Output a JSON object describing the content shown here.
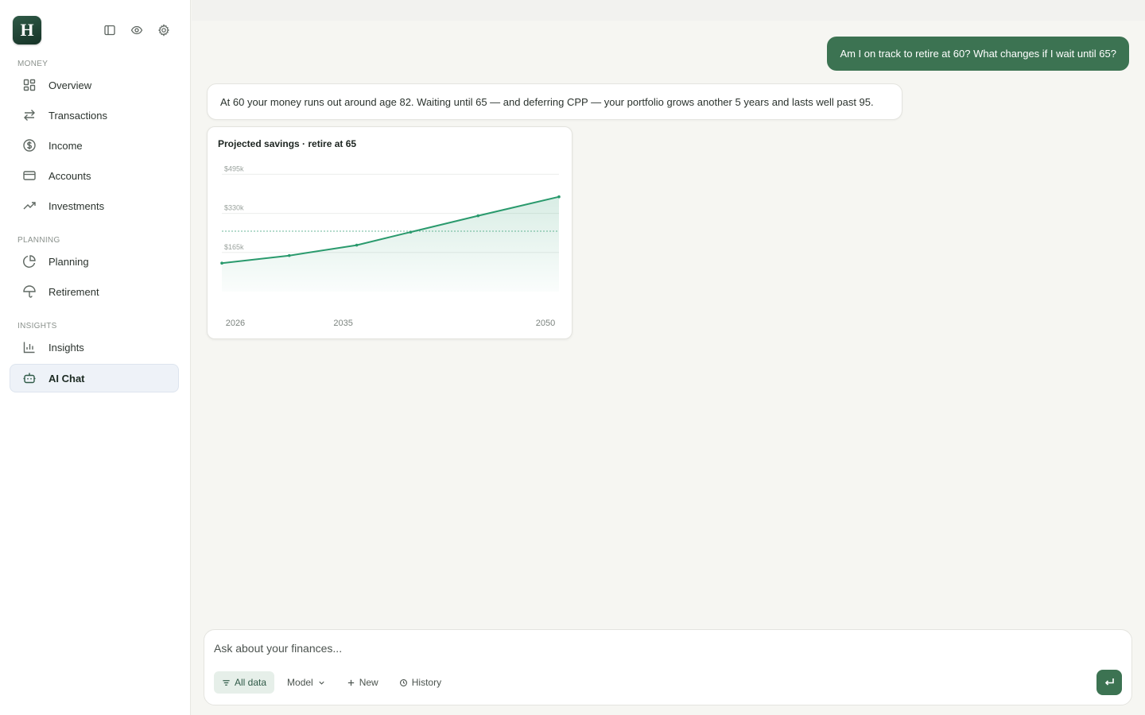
{
  "app": {
    "logo_letter": "H"
  },
  "sidebar": {
    "sections": [
      {
        "label": "MONEY"
      },
      {
        "label": "PLANNING"
      },
      {
        "label": "INSIGHTS"
      }
    ],
    "items": [
      {
        "label": "Overview",
        "icon": "grid-icon"
      },
      {
        "label": "Transactions",
        "icon": "arrows-swap-icon"
      },
      {
        "label": "Income",
        "icon": "dollar-circle-icon"
      },
      {
        "label": "Accounts",
        "icon": "credit-card-icon"
      },
      {
        "label": "Investments",
        "icon": "trending-up-icon"
      },
      {
        "label": "Planning",
        "icon": "pie-chart-icon"
      },
      {
        "label": "Retirement",
        "icon": "umbrella-icon"
      },
      {
        "label": "Insights",
        "icon": "bar-chart-icon"
      },
      {
        "label": "AI Chat",
        "icon": "robot-icon",
        "active": true
      }
    ]
  },
  "chat": {
    "user_message": "Am I on track to retire at 60? What changes if I wait until 65?",
    "ai_message": "At 60 your money runs out around age 82. Waiting until 65 — and deferring CPP — your portfolio grows another 5 years and lasts well past 95."
  },
  "chart_data": {
    "type": "area",
    "title": "Projected savings · retire at 65",
    "x": [
      2026,
      2031,
      2036,
      2040,
      2045,
      2051
    ],
    "values": [
      120,
      152,
      196,
      251,
      320,
      400
    ],
    "y_ticks": [
      165,
      330,
      495
    ],
    "y_tick_labels": [
      "$165k",
      "$330k",
      "$495k"
    ],
    "x_tick_labels": [
      "2026",
      "2035",
      "2050"
    ],
    "x_ticks": [
      2027,
      2035,
      2050
    ],
    "reference_line": 255,
    "xlim": [
      2026,
      2051
    ],
    "ylim": [
      0,
      560
    ],
    "unit": "$k",
    "color": "#2a9a6d",
    "grid": true
  },
  "composer": {
    "placeholder": "Ask about your finances...",
    "tools": [
      {
        "label": "All data",
        "icon": "filter-icon",
        "active": true
      },
      {
        "label": "Model",
        "icon": "chevron-down-icon"
      },
      {
        "label": "New",
        "icon": "plus-icon"
      },
      {
        "label": "History",
        "icon": "clock-icon"
      }
    ],
    "send_icon": "enter-arrow-icon"
  },
  "colors": {
    "accent": "#3c7352",
    "chart_line": "#2a9a6d",
    "sidebar_active_bg": "#eef2f8"
  }
}
